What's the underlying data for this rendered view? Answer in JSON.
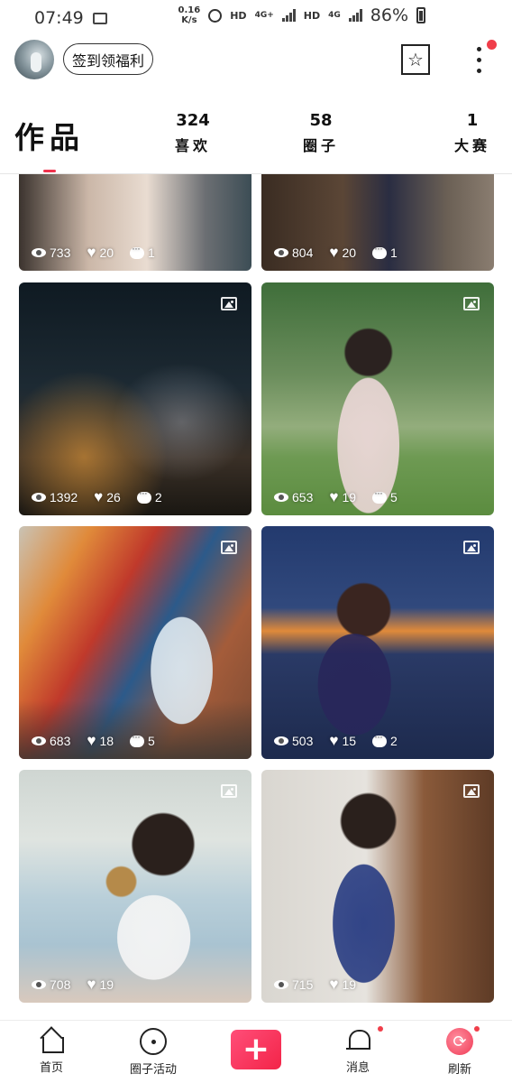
{
  "status_bar": {
    "time": "07:49",
    "net_speed_value": "0.16",
    "net_speed_unit": "K/s",
    "hd1": "HD",
    "network1": "4G+",
    "hd2": "HD",
    "network2": "4G",
    "battery": "86%"
  },
  "header": {
    "checkin_label": "签到领福利"
  },
  "tabs": {
    "works_label": "作品",
    "likes": {
      "count": "324",
      "label": "喜欢"
    },
    "circles": {
      "count": "58",
      "label": "圈子"
    },
    "contests": {
      "count": "1",
      "label": "大赛"
    }
  },
  "posts": [
    {
      "views": "733",
      "likes": "20",
      "comments": "1"
    },
    {
      "views": "804",
      "likes": "20",
      "comments": "1"
    },
    {
      "views": "1392",
      "likes": "26",
      "comments": "2"
    },
    {
      "views": "653",
      "likes": "19",
      "comments": "5"
    },
    {
      "views": "683",
      "likes": "18",
      "comments": "5"
    },
    {
      "views": "503",
      "likes": "15",
      "comments": "2"
    },
    {
      "views": "708",
      "likes": "19",
      "comments": ""
    },
    {
      "views": "715",
      "likes": "19",
      "comments": ""
    }
  ],
  "bottom_nav": {
    "home": "首页",
    "circle_activity": "圈子活动",
    "publish": "+",
    "messages": "消息",
    "refresh": "刷新"
  },
  "colors": {
    "accent": "#f0334d",
    "notification_dot": "#f03e4a"
  }
}
